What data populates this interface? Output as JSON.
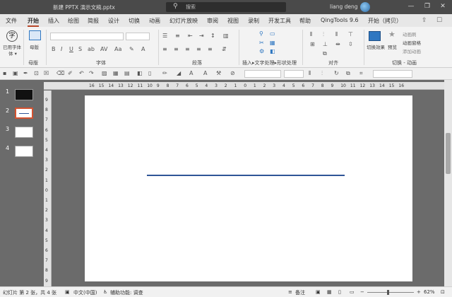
{
  "titlebar": {
    "doc_title": "新建 PPTX 演示文稿.pptx",
    "search_placeholder": "搜索",
    "user": "liang deng",
    "minimize": "—",
    "restore": "❐",
    "close": "✕"
  },
  "tabs": [
    {
      "label": "文件"
    },
    {
      "label": "开始"
    },
    {
      "label": "插入"
    },
    {
      "label": "绘图"
    },
    {
      "label": "简报"
    },
    {
      "label": "设计"
    },
    {
      "label": "切换"
    },
    {
      "label": "动画"
    },
    {
      "label": "幻灯片放映"
    },
    {
      "label": "审阅"
    },
    {
      "label": "视图"
    },
    {
      "label": "录制"
    },
    {
      "label": "开发工具"
    },
    {
      "label": "帮助"
    },
    {
      "label": "QingTools 9.6"
    },
    {
      "label": "开始（拷贝）"
    }
  ],
  "active_tab": "开始",
  "ribbon": {
    "used_fonts": "已用字体",
    "master": "母版",
    "groups": {
      "master": "母版",
      "font": "字体",
      "paragraph": "段落",
      "insert": "插入▸文字处理▸形状处理",
      "align": "对齐",
      "switch": "切换 - 动画"
    },
    "transition_effect": "切换效果",
    "preview": "预览",
    "animation_pane": "动画窗格",
    "animation_painter": "动画刷",
    "add_animation": "添加动画"
  },
  "slides": [
    {
      "number": "1"
    },
    {
      "number": "2"
    },
    {
      "number": "3"
    },
    {
      "number": "4"
    }
  ],
  "selected_slide": 2,
  "hruler": [
    "16",
    "15",
    "14",
    "13",
    "12",
    "11",
    "10",
    "9",
    "8",
    "7",
    "6",
    "5",
    "4",
    "3",
    "2",
    "1",
    "0",
    "1",
    "2",
    "3",
    "4",
    "5",
    "6",
    "7",
    "8",
    "9",
    "10",
    "11",
    "12",
    "13",
    "14",
    "15",
    "16"
  ],
  "vruler": [
    "9",
    "8",
    "7",
    "6",
    "5",
    "4",
    "3",
    "2",
    "1",
    "0",
    "1",
    "2",
    "3",
    "4",
    "5",
    "6",
    "7",
    "8",
    "9"
  ],
  "status": {
    "slide_info": "幻灯片 第 2 张，共 4 张",
    "language": "中文(中国)",
    "accessibility": "辅助功能: 调查",
    "notes": "备注",
    "zoom": "62%"
  },
  "colors": {
    "accent": "#b7472a",
    "line": "#2f5597"
  }
}
